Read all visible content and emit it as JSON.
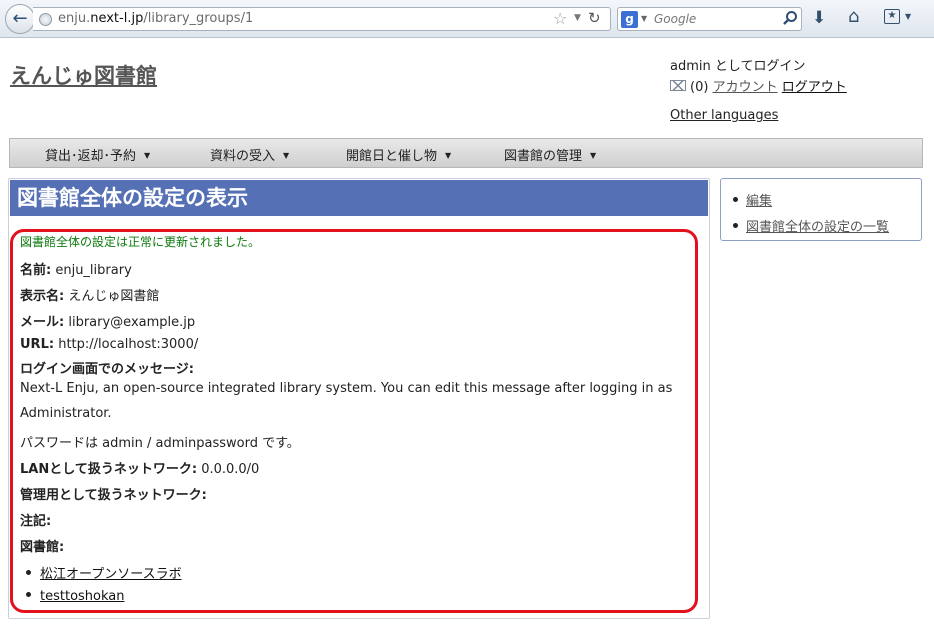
{
  "browser": {
    "url_prefix": "enju.",
    "url_domain": "next-l.jp",
    "url_path": "/library_groups/1",
    "search_placeholder": "Google"
  },
  "site": {
    "title": "えんじゅ図書館",
    "login_status": "admin としてログイン",
    "message_count": "(0)",
    "account_link": "アカウント",
    "logout_link": "ログアウト",
    "other_languages": "Other languages"
  },
  "nav": {
    "items": [
      {
        "label": "貸出･返却･予約"
      },
      {
        "label": "資料の受入"
      },
      {
        "label": "開館日と催し物"
      },
      {
        "label": "図書館の管理"
      }
    ]
  },
  "main": {
    "title": "図書館全体の設定の表示",
    "notice": "図書館全体の設定は正常に更新されました。",
    "name_label": "名前:",
    "name_value": "enju_library",
    "display_name_label": "表示名:",
    "display_name_value": "えんじゅ図書館",
    "email_label": "メール:",
    "email_value": "library@example.jp",
    "url_label": "URL:",
    "url_value": "http://localhost:3000/",
    "login_message_label": "ログイン画面でのメッセージ:",
    "login_message_line1": "Next-L Enju, an open-source integrated library system. You can edit this message after logging in as",
    "login_message_line2": "Administrator.",
    "login_message_line3": "パスワードは admin / adminpassword です。",
    "lan_label": "LANとして扱うネットワーク:",
    "lan_value": "0.0.0.0/0",
    "admin_network_label": "管理用として扱うネットワーク:",
    "note_label": "注記:",
    "libraries_label": "図書館:",
    "libraries": [
      {
        "name": "松江オープンソースラボ"
      },
      {
        "name": "testtoshokan"
      }
    ]
  },
  "sidebar": {
    "items": [
      {
        "label": "編集"
      },
      {
        "label": "図書館全体の設定の一覧"
      }
    ]
  },
  "colors": {
    "panel_header": "#5670b5",
    "notice_text": "#0c7a0c",
    "highlight_border": "#e3101e"
  }
}
